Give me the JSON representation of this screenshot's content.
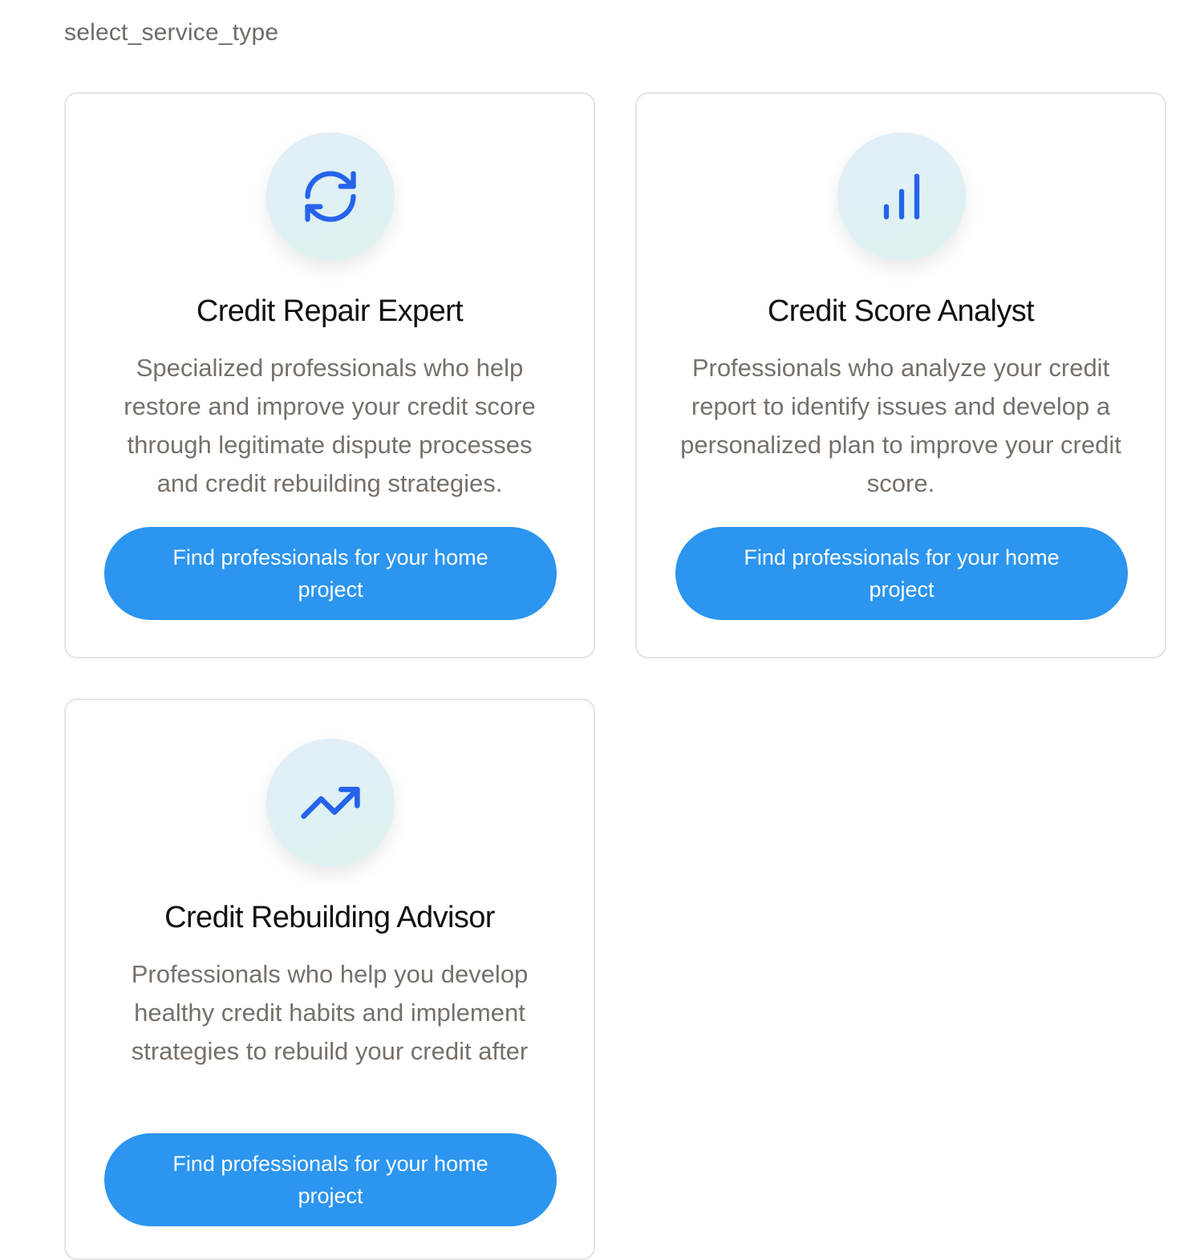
{
  "page": {
    "label": "select_service_type"
  },
  "colors": {
    "accent": "#2b95ef",
    "icon_stroke": "#2563eb",
    "title": "#111111",
    "description": "#77706a",
    "card_border": "#e4e4e4"
  },
  "cards": [
    {
      "icon": "refresh-icon",
      "title": "Credit Repair Expert",
      "description": "Specialized professionals who help restore and improve your credit score through legitimate dispute processes and credit rebuilding strategies.",
      "button_label": "Find professionals for your home project"
    },
    {
      "icon": "bar-chart-icon",
      "title": "Credit Score Analyst",
      "description": "Professionals who analyze your credit report to identify issues and develop a personalized plan to improve your credit score.",
      "button_label": "Find professionals for your home project"
    },
    {
      "icon": "trending-up-icon",
      "title": "Credit Rebuilding Advisor",
      "description": "Professionals who help you develop healthy credit habits and implement strategies to rebuild your credit after",
      "button_label": "Find professionals for your home project"
    }
  ]
}
